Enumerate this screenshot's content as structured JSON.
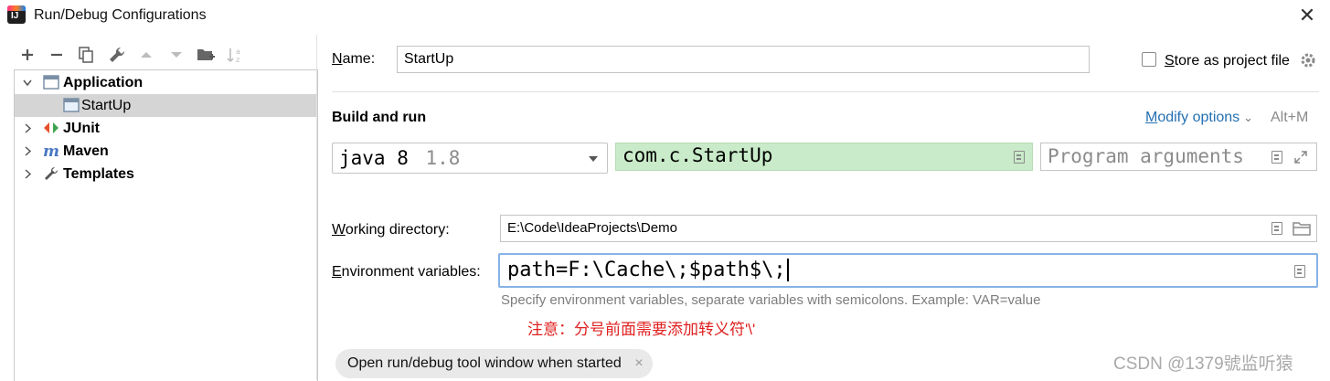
{
  "window": {
    "title": "Run/Debug Configurations",
    "app_icon": "intellij-logo",
    "close_glyph": "✕"
  },
  "toolbar": {
    "icons": [
      "add-icon",
      "remove-icon",
      "copy-icon",
      "wrench-icon",
      "move-up-icon",
      "move-down-icon",
      "folder-add-icon",
      "sort-icon"
    ]
  },
  "tree": {
    "items": [
      {
        "label": "Application",
        "icon": "application-icon",
        "expanded": true
      },
      {
        "label": "StartUp",
        "icon": "application-config-icon",
        "selected": true
      },
      {
        "label": "JUnit",
        "icon": "junit-icon"
      },
      {
        "label": "Maven",
        "icon": "maven-icon"
      },
      {
        "label": "Templates",
        "icon": "wrench-icon"
      }
    ]
  },
  "form": {
    "name_label_first": "N",
    "name_label_rest": "ame:",
    "name_value": "StartUp",
    "store_label_first": "S",
    "store_label_rest": "tore as project file",
    "store_checked": false,
    "build_run_heading": "Build and run",
    "modify_first": "M",
    "modify_rest": "odify options",
    "modify_chevron": "⌄",
    "modify_shortcut": "Alt+M",
    "jdk_name": "java 8",
    "jdk_version": "1.8",
    "main_class": "com.c.StartUp",
    "program_args_placeholder": "Program arguments",
    "working_dir_first": "W",
    "working_dir_rest": "orking directory:",
    "working_dir_value": "E:\\Code\\IdeaProjects\\Demo",
    "env_first": "E",
    "env_rest": "nvironment variables:",
    "env_value": "path=F:\\Cache\\;$path$\\;",
    "env_hint": "Specify environment variables, separate variables with semicolons. Example: VAR=value",
    "note": "注意：分号前面需要添加转义符'\\'",
    "chip_label": "Open run/debug tool window when started",
    "chip_close": "×"
  },
  "watermark": "CSDN @1379號监听猿",
  "colors": {
    "main_class_bg": "#c9ebc9",
    "selection_bg": "#d5d5d5",
    "link": "#2470b3",
    "focus_border": "#86b3e6",
    "note": "#e02020"
  }
}
